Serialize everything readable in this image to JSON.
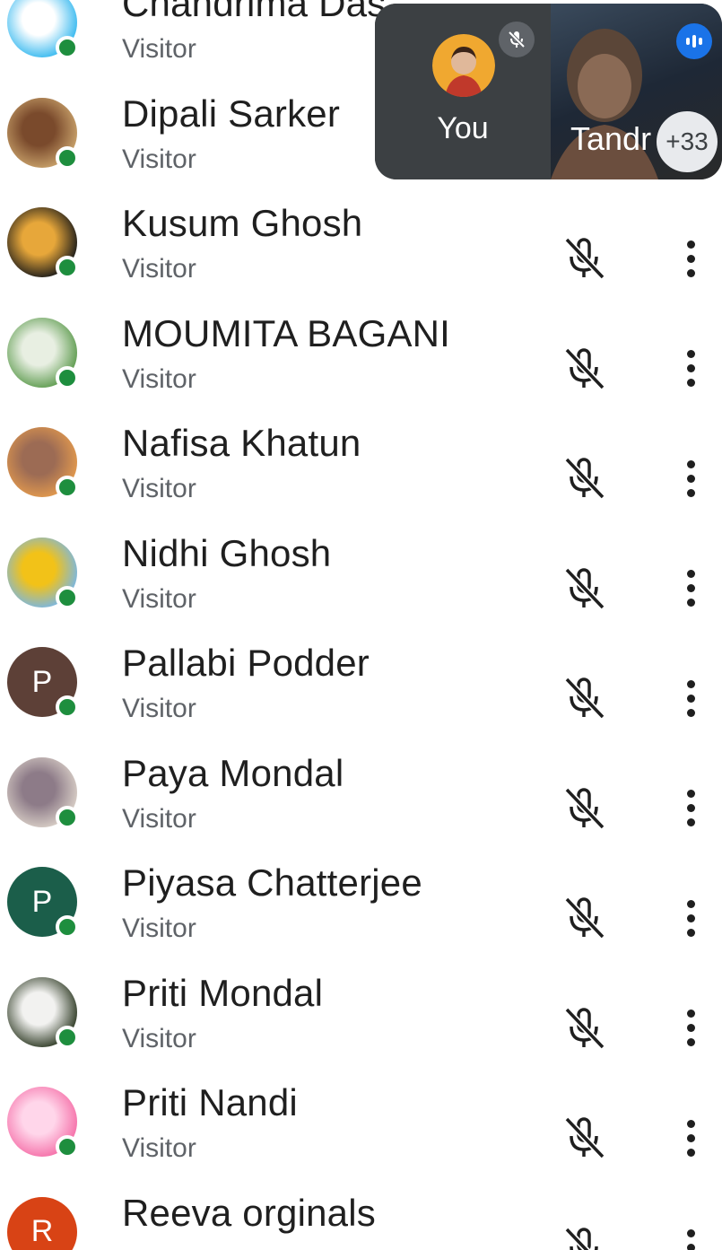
{
  "participants": [
    {
      "name": "Chandrima Das",
      "role": "Visitor",
      "avatar": "panda-photo",
      "colors": [
        "#35b8ef",
        "#ffffff"
      ]
    },
    {
      "name": "Dipali Sarker",
      "role": "Visitor",
      "avatar": "family-photo",
      "colors": [
        "#c9a26b",
        "#7a4a2c"
      ]
    },
    {
      "name": "Kusum Ghosh",
      "role": "Visitor",
      "avatar": "deity-photo",
      "colors": [
        "#1a1a1a",
        "#e7a73a"
      ]
    },
    {
      "name": "MOUMITA BAGANI",
      "role": "Visitor",
      "avatar": "garden-photo",
      "colors": [
        "#5d9b4e",
        "#e8efe2"
      ]
    },
    {
      "name": "Nafisa Khatun",
      "role": "Visitor",
      "avatar": "sunset-photo",
      "colors": [
        "#e39a4e",
        "#9c6b54"
      ]
    },
    {
      "name": "Nidhi Ghosh",
      "role": "Visitor",
      "avatar": "flower-photo",
      "colors": [
        "#78b7e6",
        "#f2c218"
      ]
    },
    {
      "name": "Pallabi Podder",
      "role": "Visitor",
      "avatar": "letter",
      "letter": "P",
      "colors": [
        "#5d4037",
        "#5d4037"
      ]
    },
    {
      "name": "Paya Mondal",
      "role": "Visitor",
      "avatar": "group-photo",
      "colors": [
        "#d9cfc7",
        "#8d7b88"
      ]
    },
    {
      "name": "Piyasa Chatterjee",
      "role": "Visitor",
      "avatar": "letter",
      "letter": "P",
      "colors": [
        "#1b5e4a",
        "#1b5e4a"
      ]
    },
    {
      "name": "Priti Mondal",
      "role": "Visitor",
      "avatar": "white-flower-photo",
      "colors": [
        "#2f3b25",
        "#f2f2f0"
      ]
    },
    {
      "name": "Priti Nandi",
      "role": "Visitor",
      "avatar": "hearts-photo",
      "colors": [
        "#f56fa8",
        "#ffd6ea"
      ]
    },
    {
      "name": "Reeva orginals",
      "role": "",
      "avatar": "letter",
      "letter": "R",
      "colors": [
        "#d84315",
        "#d84315"
      ]
    }
  ],
  "icons": {
    "mic_off": "mic-off-icon",
    "more": "more-vert-icon",
    "online": "online-status-dot"
  },
  "call_preview": {
    "self_label": "You",
    "remote_label": "Tandr",
    "more_count": "+33"
  },
  "colors": {
    "online": "#1e8e3e",
    "speaking": "#1a73e8",
    "pip_bg": "#3c4043"
  }
}
